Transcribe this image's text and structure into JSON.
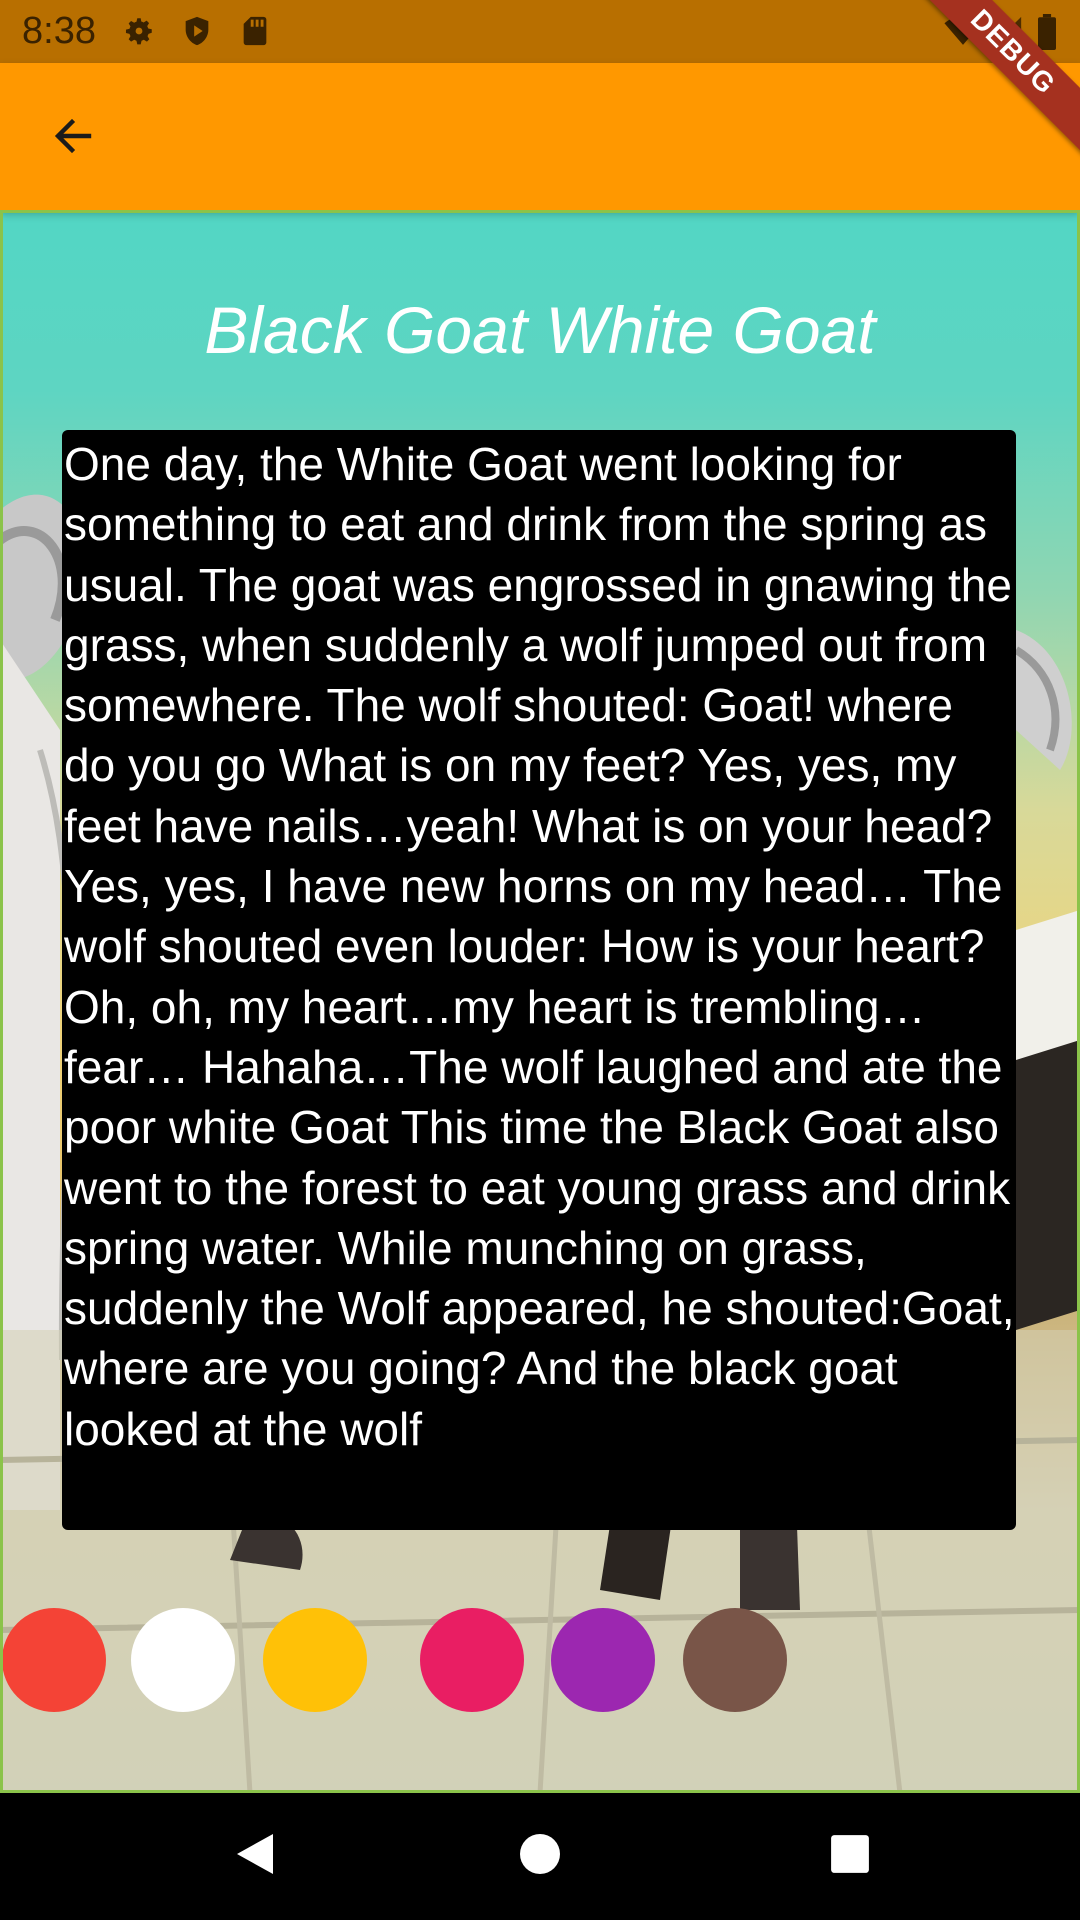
{
  "status_bar": {
    "time": "8:38",
    "icons": [
      "gear-icon",
      "shield-play-icon",
      "sd-card-icon",
      "wifi-icon",
      "signal-icon",
      "battery-icon"
    ]
  },
  "debug_banner": {
    "label": "DEBUG",
    "color": "#A5311F"
  },
  "app_bar": {
    "color": "#FF9800",
    "back_icon": "arrow-back-icon"
  },
  "story": {
    "title": "Black Goat White Goat",
    "text": "One day, the White Goat went looking for something to eat and drink from the spring as usual. The goat was engrossed in gnawing the grass, when suddenly a wolf jumped out from somewhere. The wolf shouted: Goat! where do you go What is on my feet? Yes, yes, my feet have nails…yeah! What is on your head?Yes, yes, I have new horns on my head… The wolf shouted even louder: How is your heart? Oh, oh, my heart…my heart is trembling…fear… Hahaha…The wolf laughed and ate the poor white Goat This time the Black Goat also went to the forest to eat young grass and drink spring water. While munching on grass, suddenly the Wolf appeared, he shouted:Goat, where are you going? And the black goat looked at the wolf",
    "box_color": "#000000",
    "text_color": "#FFFFFF"
  },
  "color_swatches": [
    {
      "name": "red",
      "color": "#F44336"
    },
    {
      "name": "white",
      "color": "#FFFFFF"
    },
    {
      "name": "amber",
      "color": "#FFC107"
    },
    {
      "name": "pink",
      "color": "#E91E63"
    },
    {
      "name": "purple",
      "color": "#9C27B0"
    },
    {
      "name": "brown",
      "color": "#795548"
    }
  ],
  "nav_bar": {
    "buttons": [
      "back-triangle-icon",
      "home-circle-icon",
      "recents-square-icon"
    ]
  }
}
